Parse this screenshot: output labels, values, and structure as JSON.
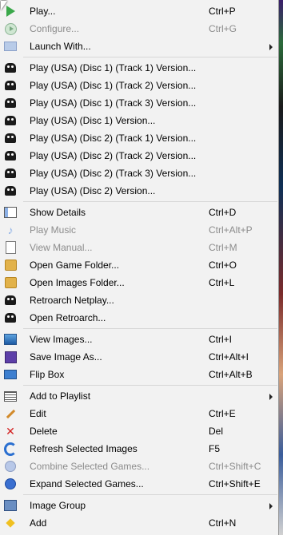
{
  "menu": {
    "items": [
      {
        "label": "Play...",
        "shortcut": "Ctrl+P",
        "icon": "play-arrow-icon",
        "disabled": false,
        "submenu": false
      },
      {
        "label": "Configure...",
        "shortcut": "Ctrl+G",
        "icon": "configure-play-icon",
        "disabled": true,
        "submenu": false
      },
      {
        "label": "Launch With...",
        "shortcut": "",
        "icon": "launch-icon",
        "disabled": false,
        "submenu": true
      },
      {
        "label": "Play (USA) (Disc 1) (Track 1) Version...",
        "shortcut": "",
        "icon": "retroarch-icon",
        "disabled": false,
        "submenu": false
      },
      {
        "label": "Play (USA) (Disc 1) (Track 2) Version...",
        "shortcut": "",
        "icon": "retroarch-icon",
        "disabled": false,
        "submenu": false
      },
      {
        "label": "Play (USA) (Disc 1) (Track 3) Version...",
        "shortcut": "",
        "icon": "retroarch-icon",
        "disabled": false,
        "submenu": false
      },
      {
        "label": "Play (USA) (Disc 1) Version...",
        "shortcut": "",
        "icon": "retroarch-icon",
        "disabled": false,
        "submenu": false
      },
      {
        "label": "Play (USA) (Disc 2) (Track 1) Version...",
        "shortcut": "",
        "icon": "retroarch-icon",
        "disabled": false,
        "submenu": false
      },
      {
        "label": "Play (USA) (Disc 2) (Track 2) Version...",
        "shortcut": "",
        "icon": "retroarch-icon",
        "disabled": false,
        "submenu": false
      },
      {
        "label": "Play (USA) (Disc 2) (Track 3) Version...",
        "shortcut": "",
        "icon": "retroarch-icon",
        "disabled": false,
        "submenu": false
      },
      {
        "label": "Play (USA) (Disc 2) Version...",
        "shortcut": "",
        "icon": "retroarch-icon",
        "disabled": false,
        "submenu": false
      },
      {
        "label": "Show Details",
        "shortcut": "Ctrl+D",
        "icon": "details-icon",
        "disabled": false,
        "submenu": false
      },
      {
        "label": "Play Music",
        "shortcut": "Ctrl+Alt+P",
        "icon": "music-note-icon",
        "disabled": true,
        "submenu": false
      },
      {
        "label": "View Manual...",
        "shortcut": "Ctrl+M",
        "icon": "manual-icon",
        "disabled": true,
        "submenu": false
      },
      {
        "label": "Open Game Folder...",
        "shortcut": "Ctrl+O",
        "icon": "folder-icon",
        "disabled": false,
        "submenu": false
      },
      {
        "label": "Open Images Folder...",
        "shortcut": "Ctrl+L",
        "icon": "images-folder-icon",
        "disabled": false,
        "submenu": false
      },
      {
        "label": "Retroarch Netplay...",
        "shortcut": "",
        "icon": "netplay-icon",
        "disabled": false,
        "submenu": false
      },
      {
        "label": "Open Retroarch...",
        "shortcut": "",
        "icon": "retroarch-icon",
        "disabled": false,
        "submenu": false
      },
      {
        "label": "View Images...",
        "shortcut": "Ctrl+I",
        "icon": "image-icon",
        "disabled": false,
        "submenu": false
      },
      {
        "label": "Save Image As...",
        "shortcut": "Ctrl+Alt+I",
        "icon": "save-disk-icon",
        "disabled": false,
        "submenu": false
      },
      {
        "label": "Flip Box",
        "shortcut": "Ctrl+Alt+B",
        "icon": "flip-box-icon",
        "disabled": false,
        "submenu": false
      },
      {
        "label": "Add to Playlist",
        "shortcut": "",
        "icon": "playlist-icon",
        "disabled": false,
        "submenu": true
      },
      {
        "label": "Edit",
        "shortcut": "Ctrl+E",
        "icon": "pencil-icon",
        "disabled": false,
        "submenu": false
      },
      {
        "label": "Delete",
        "shortcut": "Del",
        "icon": "delete-x-icon",
        "disabled": false,
        "submenu": false
      },
      {
        "label": "Refresh Selected Images",
        "shortcut": "F5",
        "icon": "refresh-icon",
        "disabled": false,
        "submenu": false
      },
      {
        "label": "Combine Selected Games...",
        "shortcut": "Ctrl+Shift+C",
        "icon": "combine-icon",
        "disabled": true,
        "submenu": false
      },
      {
        "label": "Expand Selected Games...",
        "shortcut": "Ctrl+Shift+E",
        "icon": "expand-icon",
        "disabled": false,
        "submenu": false
      },
      {
        "label": "Image Group",
        "shortcut": "",
        "icon": "image-group-icon",
        "disabled": false,
        "submenu": true
      },
      {
        "label": "Add",
        "shortcut": "Ctrl+N",
        "icon": "add-icon",
        "disabled": false,
        "submenu": false
      }
    ]
  }
}
